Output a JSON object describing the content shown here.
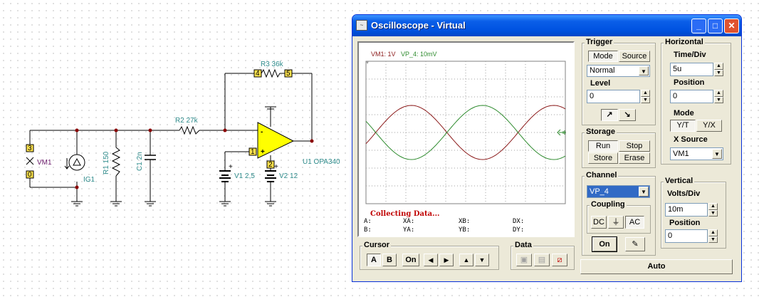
{
  "schematic": {
    "vm1_label": "VM1",
    "vm1_pin_top": "3",
    "vm1_pin_bottom": "0",
    "ig1_label": "IG1",
    "r1_label": "R1 150",
    "c1_label": "C1 2n",
    "r2_label": "R2 27k",
    "r3_label": "R3 36k",
    "r3_pin_left": "4",
    "r3_pin_right": "5",
    "opamp_label": "U1 OPA340",
    "opamp_in_pin": "1",
    "opamp_supply_pin": "2",
    "v1_label": "V1 2,5",
    "v2_label": "V2 12",
    "plus": "+",
    "minus": "-"
  },
  "window": {
    "title": "Oscilloscope - Virtual",
    "minimize": "_",
    "maximize": "□",
    "close": "✕"
  },
  "scope": {
    "legend_vm1": "VM1: 1V",
    "legend_vp4": "VP_4: 10mV",
    "status": "Collecting Data...",
    "colors": {
      "vm1": "#8b1a1a",
      "vp4": "#2e8b2e",
      "status": "#c00000",
      "grid": "#a0a0a0"
    },
    "cursor_table": [
      [
        "A:",
        "XA:",
        "XB:",
        "DX:"
      ],
      [
        "B:",
        "YA:",
        "YB:",
        "DY:"
      ]
    ]
  },
  "trigger": {
    "title": "Trigger",
    "mode_btn": "Mode",
    "source_btn": "Source",
    "mode_value": "Normal",
    "level_label": "Level",
    "level_value": "0"
  },
  "horizontal": {
    "title": "Horizontal",
    "time_label": "Time/Div",
    "time_value": "5u",
    "position_label": "Position",
    "position_value": "0",
    "mode_label": "Mode",
    "yt": "Y/T",
    "yx": "Y/X",
    "xsource_label": "X Source",
    "xsource_value": "VM1"
  },
  "storage": {
    "title": "Storage",
    "run": "Run",
    "stop": "Stop",
    "store": "Store",
    "erase": "Erase"
  },
  "channel": {
    "title": "Channel",
    "value": "VP_4",
    "coupling_label": "Coupling",
    "dc": "DC",
    "gnd": "⏚",
    "ac": "AC",
    "on": "On"
  },
  "vertical": {
    "title": "Vertical",
    "volts_label": "Volts/Div",
    "volts_value": "10m",
    "position_label": "Position",
    "position_value": "0"
  },
  "cursor": {
    "title": "Cursor",
    "a": "A",
    "b": "B",
    "on": "On",
    "left": "◀",
    "right": "▶",
    "up": "▲",
    "down": "▼"
  },
  "data_panel": {
    "title": "Data"
  },
  "auto": "Auto"
}
